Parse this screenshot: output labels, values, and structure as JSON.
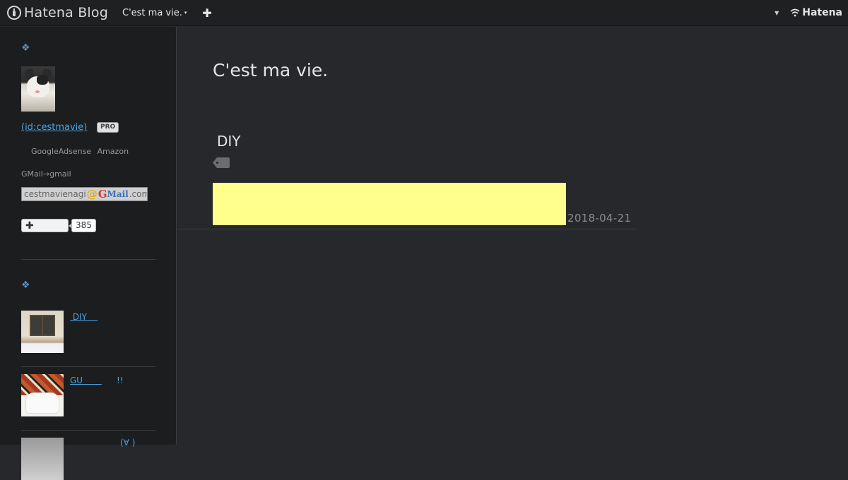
{
  "navbar": {
    "brand": "Hatena Blog",
    "blog_menu_label": "C'est ma vie.",
    "caret": "▾",
    "add_symbol": "✚",
    "user_caret": "▼",
    "hatena_logo": "Hatena"
  },
  "sidebar": {
    "profile_heading_symbol": "❖",
    "user_id": " (id:cestmavie)",
    "pro_badge": "PRO",
    "ad_links": [
      "GoogleAdsense",
      "Amazon"
    ],
    "gmail_note": "GMail→gmail",
    "email": {
      "user": "cestmavienagi",
      "at": "@",
      "g": "G",
      "mail": "Mail",
      "domain": ".com"
    },
    "follow_button_symbol": "✚",
    "follower_count": "385",
    "recent_heading_symbol": "❖",
    "entries": [
      {
        "title": " DIY    "
      },
      {
        "title": "GU       ",
        "suffix": "!!"
      },
      {
        "title": "(∀ )"
      }
    ]
  },
  "main": {
    "blog_title": "C'est ma vie.",
    "category_title": "DIY",
    "entry_date": "2018-04-21"
  },
  "colors": {
    "link": "#4aa3e0",
    "highlight": "#ffff8c",
    "background": "#26282b",
    "sidebar": "#1c1d1f",
    "navbar": "#1f2022"
  },
  "icons": {
    "brand": "hatena-bottle-icon",
    "tag": "tag-icon",
    "hatena": "hatena-wifi-icon"
  }
}
